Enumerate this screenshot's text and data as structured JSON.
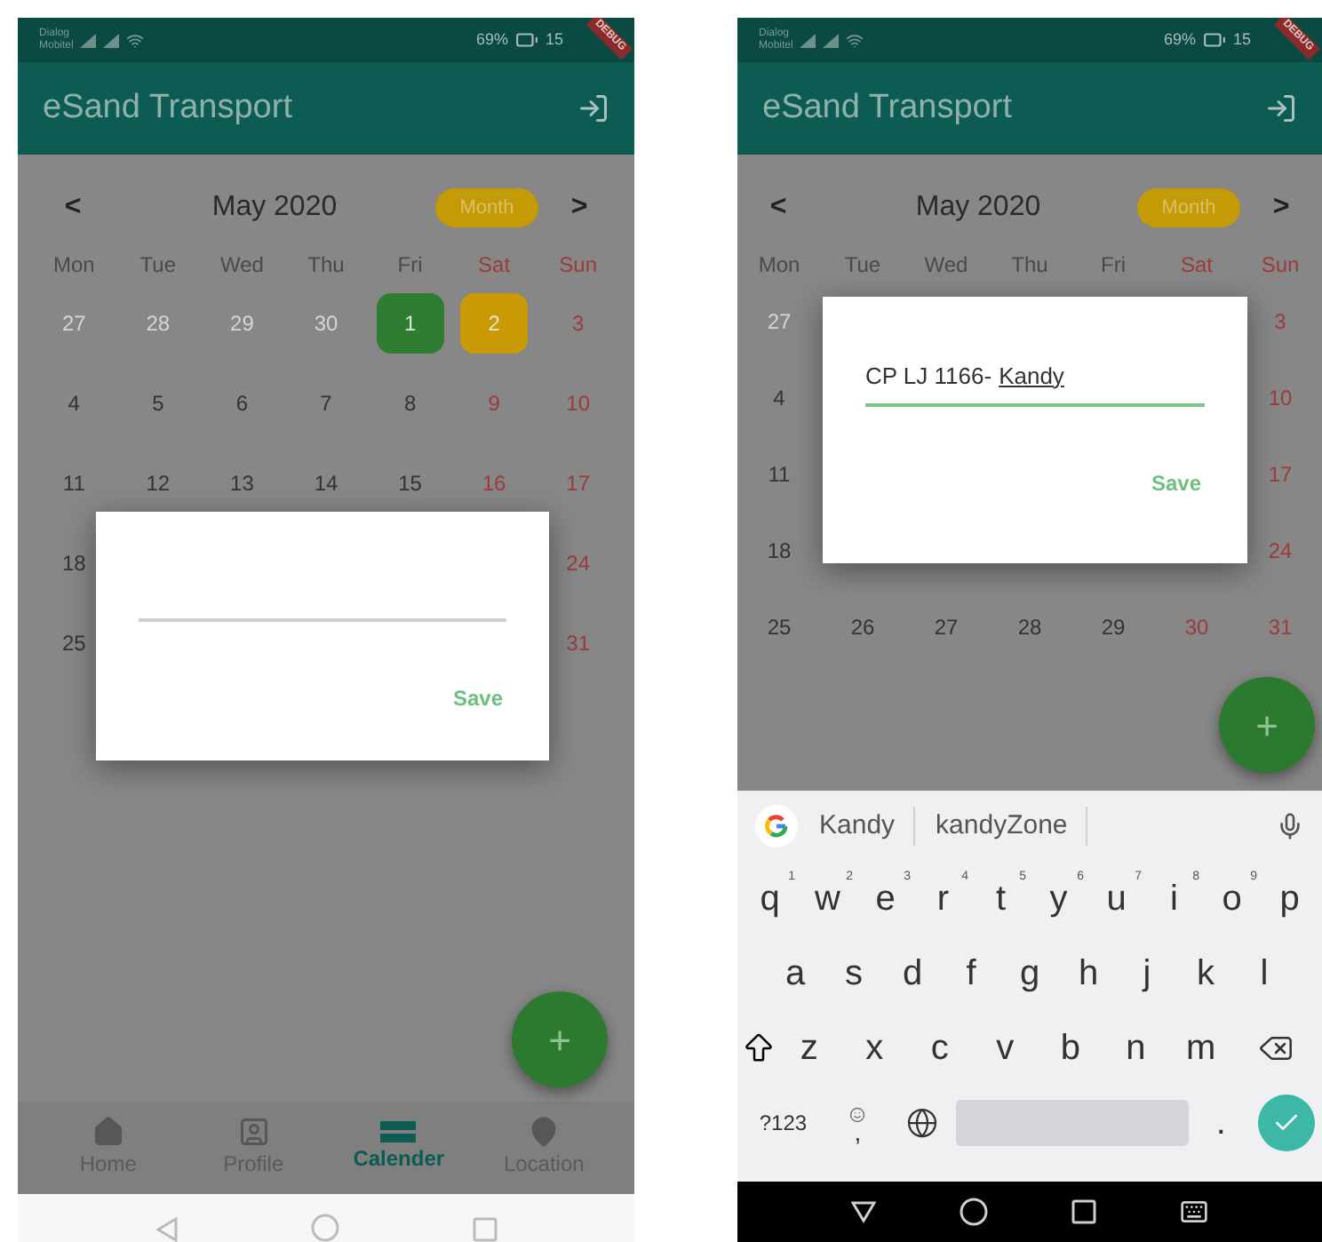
{
  "screens": [
    {
      "status": {
        "carrier": [
          "Dialog",
          "Mobitel"
        ],
        "battery": "69%",
        "time": "15"
      },
      "debug_banner": "DEBUG",
      "app_bar": {
        "title": "eSand Transport"
      },
      "calendar": {
        "prev": "<",
        "title": "May 2020",
        "format_button": "Month",
        "next": ">",
        "weekdays": [
          {
            "label": "Mon",
            "weekend": false
          },
          {
            "label": "Tue",
            "weekend": false
          },
          {
            "label": "Wed",
            "weekend": false
          },
          {
            "label": "Thu",
            "weekend": false
          },
          {
            "label": "Fri",
            "weekend": false
          },
          {
            "label": "Sat",
            "weekend": true
          },
          {
            "label": "Sun",
            "weekend": true
          }
        ],
        "rows": [
          [
            {
              "day": "27",
              "kind": "outside"
            },
            {
              "day": "28",
              "kind": "outside"
            },
            {
              "day": "29",
              "kind": "outside"
            },
            {
              "day": "30",
              "kind": "outside"
            },
            {
              "day": "1",
              "kind": "event",
              "color": "#2e7d32"
            },
            {
              "day": "2",
              "kind": "event",
              "color": "#c99a06"
            },
            {
              "day": "3",
              "kind": "weekend"
            }
          ],
          [
            {
              "day": "4",
              "kind": "day"
            },
            {
              "day": "5",
              "kind": "day"
            },
            {
              "day": "6",
              "kind": "day"
            },
            {
              "day": "7",
              "kind": "day"
            },
            {
              "day": "8",
              "kind": "day"
            },
            {
              "day": "9",
              "kind": "weekend"
            },
            {
              "day": "10",
              "kind": "weekend"
            }
          ],
          [
            {
              "day": "11",
              "kind": "day"
            },
            {
              "day": "12",
              "kind": "day"
            },
            {
              "day": "13",
              "kind": "day"
            },
            {
              "day": "14",
              "kind": "day"
            },
            {
              "day": "15",
              "kind": "day"
            },
            {
              "day": "16",
              "kind": "weekend"
            },
            {
              "day": "17",
              "kind": "weekend"
            }
          ],
          [
            {
              "day": "18",
              "kind": "day"
            },
            {
              "kind": "covered"
            },
            {
              "kind": "covered"
            },
            {
              "kind": "covered"
            },
            {
              "kind": "covered"
            },
            {
              "kind": "covered"
            },
            {
              "day": "24",
              "kind": "weekend"
            }
          ],
          [
            {
              "day": "25",
              "kind": "day"
            },
            {
              "kind": "covered"
            },
            {
              "kind": "covered"
            },
            {
              "kind": "covered"
            },
            {
              "kind": "covered"
            },
            {
              "kind": "covered"
            },
            {
              "day": "31",
              "kind": "weekend"
            }
          ]
        ]
      },
      "dialog": {
        "focused": false,
        "save": "Save"
      },
      "fab": "+",
      "bottom_nav": [
        {
          "kind": "home",
          "label": "Home",
          "selected": false
        },
        {
          "kind": "profile",
          "label": "Profile",
          "selected": false
        },
        {
          "kind": "calendar",
          "label": "Calender",
          "selected": true
        },
        {
          "kind": "location",
          "label": "Location",
          "selected": false
        }
      ]
    },
    {
      "status": {
        "carrier": [
          "Dialog",
          "Mobitel"
        ],
        "battery": "69%",
        "time": "15"
      },
      "debug_banner": "DEBUG",
      "app_bar": {
        "title": "eSand Transport"
      },
      "calendar": {
        "prev": "<",
        "title": "May 2020",
        "format_button": "Month",
        "next": ">",
        "weekdays": [
          {
            "label": "Mon",
            "weekend": false
          },
          {
            "label": "Tue",
            "weekend": false
          },
          {
            "label": "Wed",
            "weekend": false
          },
          {
            "label": "Thu",
            "weekend": false
          },
          {
            "label": "Fri",
            "weekend": false
          },
          {
            "label": "Sat",
            "weekend": true
          },
          {
            "label": "Sun",
            "weekend": true
          }
        ],
        "rows": [
          [
            {
              "day": "27",
              "kind": "outside"
            },
            {
              "kind": "covered"
            },
            {
              "kind": "covered"
            },
            {
              "kind": "covered"
            },
            {
              "kind": "covered"
            },
            {
              "kind": "covered"
            },
            {
              "day": "3",
              "kind": "weekend"
            }
          ],
          [
            {
              "day": "4",
              "kind": "day"
            },
            {
              "kind": "covered"
            },
            {
              "kind": "covered"
            },
            {
              "kind": "covered"
            },
            {
              "kind": "covered"
            },
            {
              "kind": "covered"
            },
            {
              "day": "10",
              "kind": "weekend"
            }
          ],
          [
            {
              "day": "11",
              "kind": "day"
            },
            {
              "kind": "covered"
            },
            {
              "kind": "covered"
            },
            {
              "kind": "covered"
            },
            {
              "kind": "covered"
            },
            {
              "kind": "covered"
            },
            {
              "day": "17",
              "kind": "weekend"
            }
          ],
          [
            {
              "day": "18",
              "kind": "day"
            },
            {
              "kind": "covered"
            },
            {
              "kind": "covered"
            },
            {
              "kind": "covered"
            },
            {
              "kind": "covered"
            },
            {
              "kind": "covered"
            },
            {
              "day": "24",
              "kind": "weekend"
            }
          ],
          [
            {
              "day": "25",
              "kind": "day"
            },
            {
              "day": "26",
              "kind": "day"
            },
            {
              "day": "27",
              "kind": "day"
            },
            {
              "day": "28",
              "kind": "day"
            },
            {
              "day": "29",
              "kind": "day"
            },
            {
              "day": "30",
              "kind": "weekend"
            },
            {
              "day": "31",
              "kind": "weekend"
            }
          ]
        ]
      },
      "dialog": {
        "focused": true,
        "value_parts": [
          {
            "text": "CP LJ 1166-",
            "composing": false
          },
          {
            "text": "Kandy",
            "composing": true
          }
        ],
        "save": "Save"
      },
      "fab": "+",
      "keyboard": {
        "suggestions": [
          "Kandy",
          "kandyZone"
        ],
        "rows": [
          [
            {
              "kind": "char",
              "label": "q",
              "hint": "1"
            },
            {
              "kind": "char",
              "label": "w",
              "hint": "2"
            },
            {
              "kind": "char",
              "label": "e",
              "hint": "3"
            },
            {
              "kind": "char",
              "label": "r",
              "hint": "4"
            },
            {
              "kind": "char",
              "label": "t",
              "hint": "5"
            },
            {
              "kind": "char",
              "label": "y",
              "hint": "6"
            },
            {
              "kind": "char",
              "label": "u",
              "hint": "7"
            },
            {
              "kind": "char",
              "label": "i",
              "hint": "8"
            },
            {
              "kind": "char",
              "label": "o",
              "hint": "9"
            },
            {
              "kind": "char",
              "label": "p"
            }
          ],
          [
            {
              "kind": "char",
              "label": "a"
            },
            {
              "kind": "char",
              "label": "s"
            },
            {
              "kind": "char",
              "label": "d"
            },
            {
              "kind": "char",
              "label": "f"
            },
            {
              "kind": "char",
              "label": "g"
            },
            {
              "kind": "char",
              "label": "h"
            },
            {
              "kind": "char",
              "label": "j"
            },
            {
              "kind": "char",
              "label": "k"
            },
            {
              "kind": "char",
              "label": "l"
            }
          ],
          [
            {
              "kind": "shift"
            },
            {
              "kind": "char",
              "label": "z"
            },
            {
              "kind": "char",
              "label": "x"
            },
            {
              "kind": "char",
              "label": "c"
            },
            {
              "kind": "char",
              "label": "v"
            },
            {
              "kind": "char",
              "label": "b"
            },
            {
              "kind": "char",
              "label": "n"
            },
            {
              "kind": "char",
              "label": "m"
            },
            {
              "kind": "backspace"
            }
          ],
          [
            {
              "kind": "symbols",
              "label": "?123"
            },
            {
              "kind": "emoji_comma",
              "label": ","
            },
            {
              "kind": "globe"
            },
            {
              "kind": "space"
            },
            {
              "kind": "char",
              "label": "."
            },
            {
              "kind": "enter"
            }
          ]
        ]
      }
    }
  ]
}
